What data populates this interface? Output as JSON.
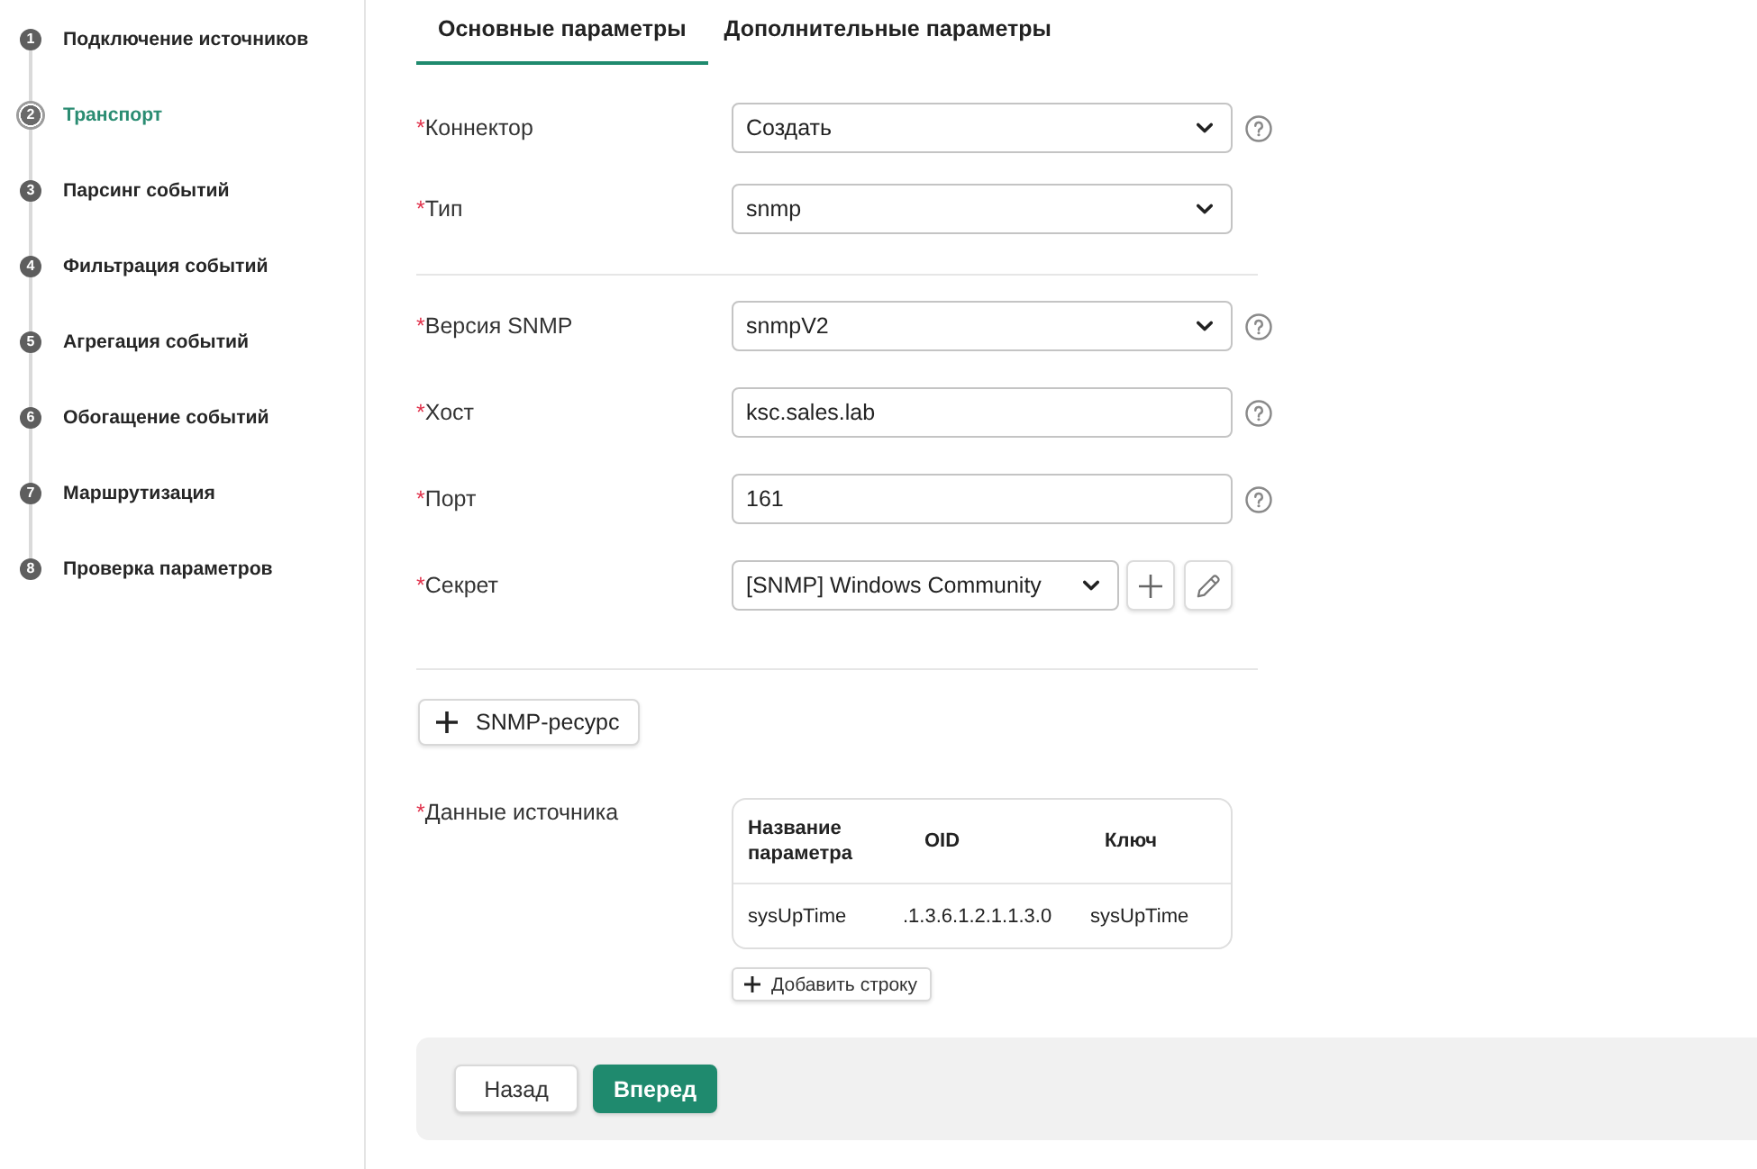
{
  "sidebar": {
    "steps": [
      {
        "number": "1",
        "label": "Подключение источников",
        "selected": false
      },
      {
        "number": "2",
        "label": "Транспорт",
        "selected": true
      },
      {
        "number": "3",
        "label": "Парсинг событий",
        "selected": false
      },
      {
        "number": "4",
        "label": "Фильтрация событий",
        "selected": false
      },
      {
        "number": "5",
        "label": "Агрегация событий",
        "selected": false
      },
      {
        "number": "6",
        "label": "Обогащение событий",
        "selected": false
      },
      {
        "number": "7",
        "label": "Маршрутизация",
        "selected": false
      },
      {
        "number": "8",
        "label": "Проверка параметров",
        "selected": false
      }
    ]
  },
  "tabs": [
    {
      "label": "Основные параметры",
      "selected": true
    },
    {
      "label": "Дополнительные параметры",
      "selected": false
    }
  ],
  "form": {
    "sections": [
      {
        "fields": [
          {
            "kind": "select",
            "required_mark": "*",
            "label": "Коннектор",
            "value": "Создать",
            "help": true
          },
          {
            "kind": "select",
            "required_mark": "*",
            "label": "Тип",
            "value": "snmp",
            "help": false
          }
        ]
      },
      {
        "fields": [
          {
            "kind": "select",
            "required_mark": "*",
            "label": "Версия SNMP",
            "value": "snmpV2",
            "help": true
          },
          {
            "kind": "input",
            "required_mark": "*",
            "label": "Хост",
            "value": "ksc.sales.lab",
            "help": true
          },
          {
            "kind": "input",
            "required_mark": "*",
            "label": "Порт",
            "value": "161",
            "help": true
          },
          {
            "kind": "select_with_actions",
            "required_mark": "*",
            "label": "Секрет",
            "value": "[SNMP] Windows Community",
            "help": false
          }
        ]
      }
    ],
    "resource_button": {
      "label": "SNMP-ресурс"
    },
    "source_data": {
      "required_mark": "*",
      "label": "Данные источника",
      "columns": [
        "Название параметра",
        "OID",
        "Ключ"
      ],
      "rows": [
        [
          "sysUpTime",
          ".1.3.6.1.2.1.1.3.0",
          "sysUpTime"
        ]
      ],
      "add_row_button": "Добавить строку"
    }
  },
  "footer": {
    "buttons": [
      {
        "kind": "secondary",
        "label": "Назад"
      },
      {
        "kind": "primary",
        "label": "Вперед"
      }
    ]
  }
}
